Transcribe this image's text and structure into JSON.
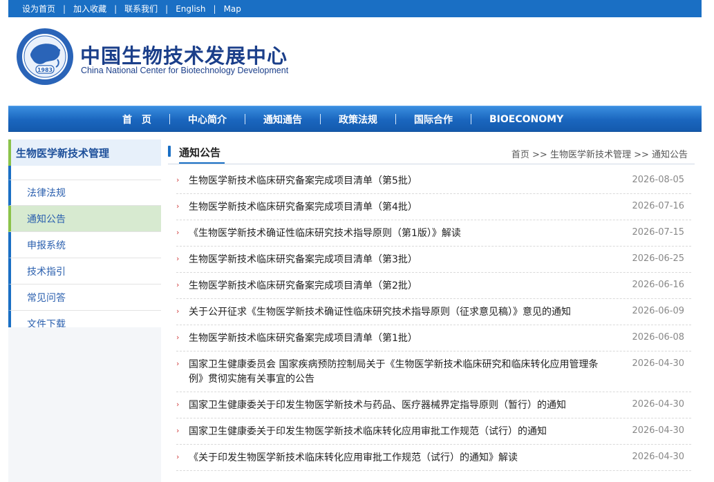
{
  "topbar": {
    "links": [
      "设为首页",
      "加入收藏",
      "联系我们",
      "English",
      "Map"
    ]
  },
  "brand": {
    "cn_name": "中国生物技术发展中心",
    "en_name": "China National Center for Biotechnology Development",
    "emblem_year": "1983"
  },
  "nav": {
    "items": [
      "首　页",
      "中心简介",
      "通知通告",
      "政策法规",
      "国际合作",
      "BIOECONOMY"
    ]
  },
  "sidebar": {
    "title": "生物医学新技术管理",
    "items": [
      "法律法规",
      "通知公告",
      "申报系统",
      "技术指引",
      "常见问答",
      "文件下载"
    ],
    "active": "通知公告"
  },
  "content": {
    "title": "通知公告",
    "breadcrumb": "首页 >> 生物医学新技术管理 >> 通知公告",
    "list": [
      {
        "title": "生物医学新技术临床研究备案完成项目清单（第5批）",
        "date": "2026-08-05"
      },
      {
        "title": "生物医学新技术临床研究备案完成项目清单（第4批）",
        "date": "2026-07-16"
      },
      {
        "title": "《生物医学新技术确证性临床研究技术指导原则（第1版）》解读",
        "date": "2026-07-15"
      },
      {
        "title": "生物医学新技术临床研究备案完成项目清单（第3批）",
        "date": "2026-06-25"
      },
      {
        "title": "生物医学新技术临床研究备案完成项目清单（第2批）",
        "date": "2026-06-16"
      },
      {
        "title": "关于公开征求《生物医学新技术确证性临床研究技术指导原则（征求意见稿）》意见的通知",
        "date": "2026-06-09"
      },
      {
        "title": "生物医学新技术临床研究备案完成项目清单（第1批）",
        "date": "2026-06-08"
      },
      {
        "title": "国家卫生健康委员会 国家疾病预防控制局关于《生物医学新技术临床研究和临床转化应用管理条例》贯彻实施有关事宜的公告",
        "date": "2026-04-30"
      },
      {
        "title": "国家卫生健康委关于印发生物医学新技术与药品、医疗器械界定指导原则（暂行）的通知",
        "date": "2026-04-30"
      },
      {
        "title": "国家卫生健康委关于印发生物医学新技术临床转化应用审批工作规范（试行）的通知",
        "date": "2026-04-30"
      },
      {
        "title": "《关于印发生物医学新技术临床转化应用审批工作规范（试行）的通知》解读",
        "date": "2026-04-30"
      }
    ]
  },
  "colors": {
    "primary_blue": "#1a6fc4",
    "brand_navy": "#1b3f8a",
    "accent_green": "#8bc34a",
    "bullet_red": "#d04040"
  }
}
